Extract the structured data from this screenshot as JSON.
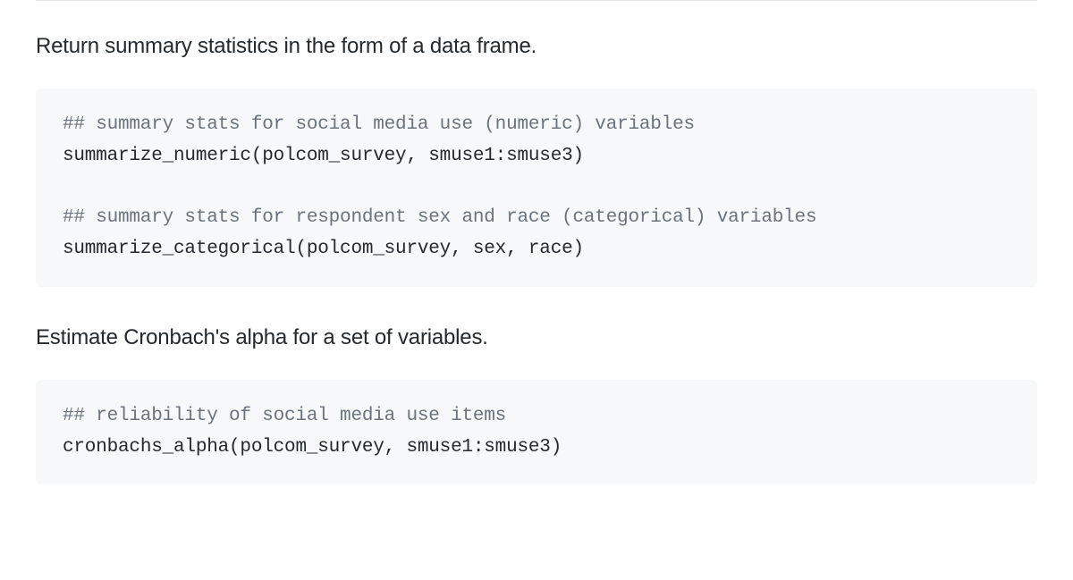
{
  "sections": [
    {
      "description": "Return summary statistics in the form of a data frame.",
      "code": {
        "lines": [
          {
            "type": "comment",
            "text": "## summary stats for social media use (numeric) variables"
          },
          {
            "type": "code",
            "text": "summarize_numeric(polcom_survey, smuse1:smuse3)"
          },
          {
            "type": "blank",
            "text": ""
          },
          {
            "type": "comment",
            "text": "## summary stats for respondent sex and race (categorical) variables"
          },
          {
            "type": "code",
            "text": "summarize_categorical(polcom_survey, sex, race)"
          }
        ]
      }
    },
    {
      "description": "Estimate Cronbach's alpha for a set of variables.",
      "code": {
        "lines": [
          {
            "type": "comment",
            "text": "## reliability of social media use items"
          },
          {
            "type": "code",
            "text": "cronbachs_alpha(polcom_survey, smuse1:smuse3)"
          }
        ]
      }
    }
  ]
}
